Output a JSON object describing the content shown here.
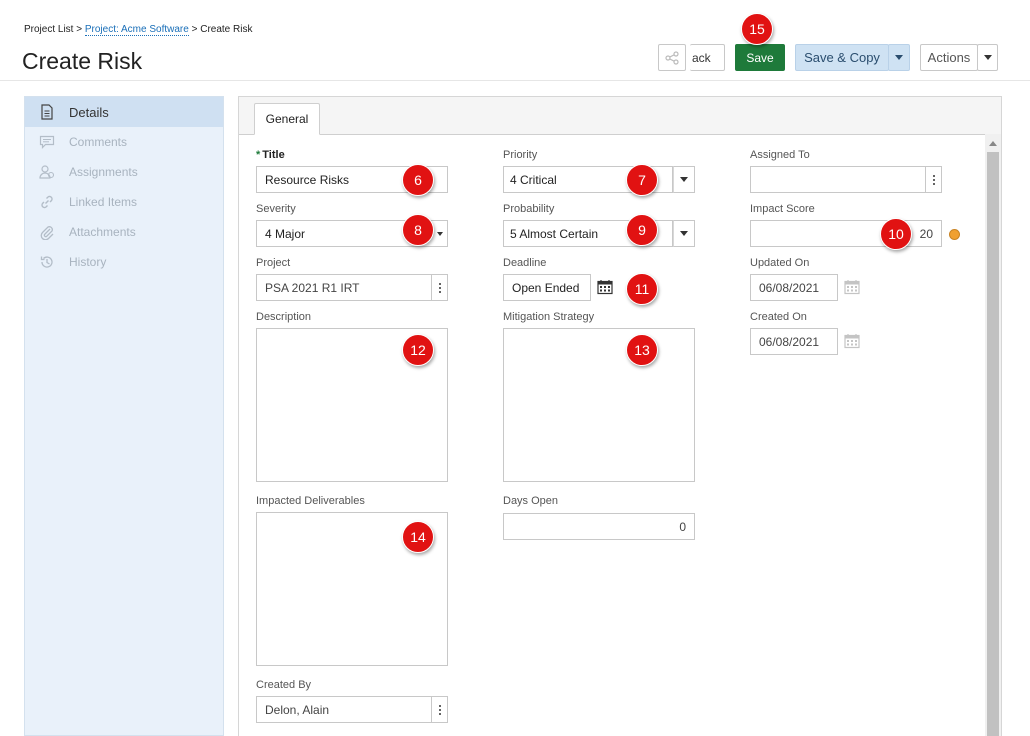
{
  "breadcrumb": {
    "root": "Project List",
    "sep": " > ",
    "project": "Project: Acme Software",
    "current": "Create Risk"
  },
  "page_title": "Create Risk",
  "toolbar": {
    "back_label": "ack",
    "save_label": "Save",
    "save_copy_label": "Save & Copy",
    "actions_label": "Actions"
  },
  "sidebar": {
    "items": [
      {
        "label": "Details",
        "icon": "document-icon",
        "active": true
      },
      {
        "label": "Comments",
        "icon": "comment-icon"
      },
      {
        "label": "Assignments",
        "icon": "users-icon"
      },
      {
        "label": "Linked Items",
        "icon": "link-icon"
      },
      {
        "label": "Attachments",
        "icon": "paperclip-icon"
      },
      {
        "label": "History",
        "icon": "history-icon"
      }
    ]
  },
  "tabs": {
    "general": "General"
  },
  "form": {
    "title": {
      "label": "Title",
      "required": "*",
      "value": "Resource Risks"
    },
    "priority": {
      "label": "Priority",
      "value": "4 Critical"
    },
    "assigned_to": {
      "label": "Assigned To",
      "value": ""
    },
    "severity": {
      "label": "Severity",
      "value": "4 Major"
    },
    "probability": {
      "label": "Probability",
      "value": "5 Almost Certain"
    },
    "impact_score": {
      "label": "Impact Score",
      "value": "20",
      "indicator_color": "#f0a030"
    },
    "project": {
      "label": "Project",
      "value": "PSA 2021 R1 IRT"
    },
    "deadline": {
      "label": "Deadline",
      "value": "Open Ended"
    },
    "updated_on": {
      "label": "Updated On",
      "value": "06/08/2021"
    },
    "description": {
      "label": "Description",
      "value": ""
    },
    "mitigation_strategy": {
      "label": "Mitigation Strategy",
      "value": ""
    },
    "created_on": {
      "label": "Created On",
      "value": "06/08/2021"
    },
    "impacted_deliverables": {
      "label": "Impacted Deliverables",
      "value": ""
    },
    "days_open": {
      "label": "Days Open",
      "value": "0"
    },
    "created_by": {
      "label": "Created By",
      "value": "Delon, Alain"
    }
  },
  "badges": {
    "b6": "6",
    "b7": "7",
    "b8": "8",
    "b9": "9",
    "b10": "10",
    "b11": "11",
    "b12": "12",
    "b13": "13",
    "b14": "14",
    "b15": "15"
  },
  "colors": {
    "save": "#1e7a3a",
    "save_copy": "#cfe2f3",
    "badge": "#e11212",
    "link": "#1a6fb8"
  }
}
